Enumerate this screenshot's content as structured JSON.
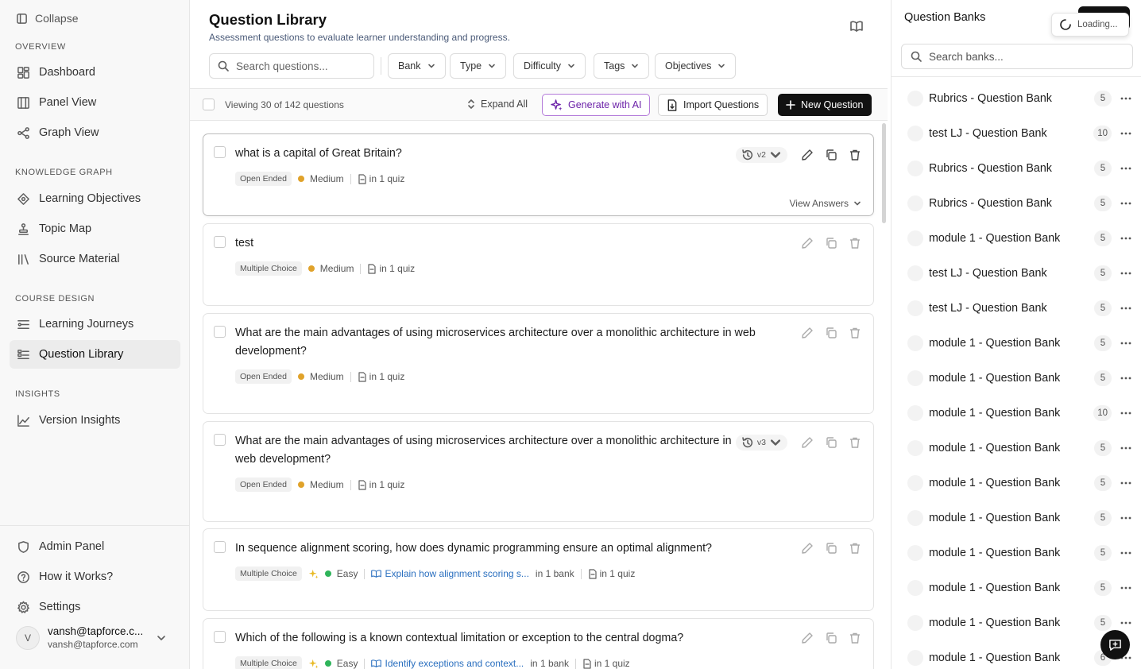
{
  "sidebar": {
    "collapse_label": "Collapse",
    "sections": {
      "overview": "OVERVIEW",
      "knowledge_graph": "KNOWLEDGE GRAPH",
      "course_design": "COURSE DESIGN",
      "insights": "INSIGHTS"
    },
    "items": {
      "dashboard": "Dashboard",
      "panel_view": "Panel View",
      "graph_view": "Graph View",
      "learning_objectives": "Learning Objectives",
      "topic_map": "Topic Map",
      "source_material": "Source Material",
      "learning_journeys": "Learning Journeys",
      "question_library": "Question Library",
      "version_insights": "Version Insights"
    },
    "bottom": {
      "admin_panel": "Admin Panel",
      "how_it_works": "How it Works?",
      "settings": "Settings"
    },
    "user": {
      "initial": "V",
      "name": "vansh@tapforce.c...",
      "email": "vansh@tapforce.com"
    }
  },
  "header": {
    "title": "Question Library",
    "subtitle": "Assessment questions to evaluate learner understanding and progress."
  },
  "filters": {
    "search_placeholder": "Search questions...",
    "bank": "Bank",
    "type": "Type",
    "difficulty": "Difficulty",
    "tags": "Tags",
    "objectives": "Objectives"
  },
  "toolbar": {
    "viewing": "Viewing 30 of 142 questions",
    "expand_all": "Expand All",
    "generate_ai": "Generate with AI",
    "import": "Import Questions",
    "new_question": "New Question"
  },
  "questions": [
    {
      "text": "what is a capital of Great Britain?",
      "type": "Open Ended",
      "difficulty": "Medium",
      "quiz": "in 1 quiz",
      "version": "v2",
      "view_answers": "View Answers"
    },
    {
      "text": "test",
      "type": "Multiple Choice",
      "difficulty": "Medium",
      "quiz": "in 1 quiz"
    },
    {
      "text": "What are the main advantages of using microservices architecture over a monolithic architecture in web development?",
      "type": "Open Ended",
      "difficulty": "Medium",
      "quiz": "in 1 quiz"
    },
    {
      "text": "What are the main advantages of using microservices architecture over a monolithic architecture in web development?",
      "type": "Open Ended",
      "difficulty": "Medium",
      "quiz": "in 1 quiz",
      "version": "v3"
    },
    {
      "text": "In sequence alignment scoring, how does dynamic programming ensure an optimal alignment?",
      "type": "Multiple Choice",
      "difficulty": "Easy",
      "objective": "Explain how alignment scoring s...",
      "bank": "in 1 bank",
      "quiz": "in 1 quiz"
    },
    {
      "text": "Which of the following is a known contextual limitation or exception to the central dogma?",
      "type": "Multiple Choice",
      "difficulty": "Easy",
      "objective": "Identify exceptions and context...",
      "bank": "in 1 bank",
      "quiz": "in 1 quiz"
    }
  ],
  "colors": {
    "medium": "#e0a22a",
    "easy": "#2fb45a",
    "accent_ai": "#6b21a8",
    "link": "#2a6fbf"
  },
  "right_panel": {
    "title": "Question Banks",
    "loading": "Loading...",
    "search_placeholder": "Search banks...",
    "banks": [
      {
        "name": "Rubrics - Question Bank",
        "count": "5"
      },
      {
        "name": "test LJ - Question Bank",
        "count": "10"
      },
      {
        "name": "Rubrics - Question Bank",
        "count": "5"
      },
      {
        "name": "Rubrics - Question Bank",
        "count": "5"
      },
      {
        "name": "module 1 - Question Bank",
        "count": "5"
      },
      {
        "name": "test LJ - Question Bank",
        "count": "5"
      },
      {
        "name": "test LJ - Question Bank",
        "count": "5"
      },
      {
        "name": "module 1 - Question Bank",
        "count": "5"
      },
      {
        "name": "module 1 - Question Bank",
        "count": "5"
      },
      {
        "name": "module 1 - Question Bank",
        "count": "10"
      },
      {
        "name": "module 1 - Question Bank",
        "count": "5"
      },
      {
        "name": "module 1 - Question Bank",
        "count": "5"
      },
      {
        "name": "module 1 - Question Bank",
        "count": "5"
      },
      {
        "name": "module 1 - Question Bank",
        "count": "5"
      },
      {
        "name": "module 1 - Question Bank",
        "count": "5"
      },
      {
        "name": "module 1 - Question Bank",
        "count": "5"
      },
      {
        "name": "module 1 - Question Bank",
        "count": "6"
      }
    ]
  }
}
